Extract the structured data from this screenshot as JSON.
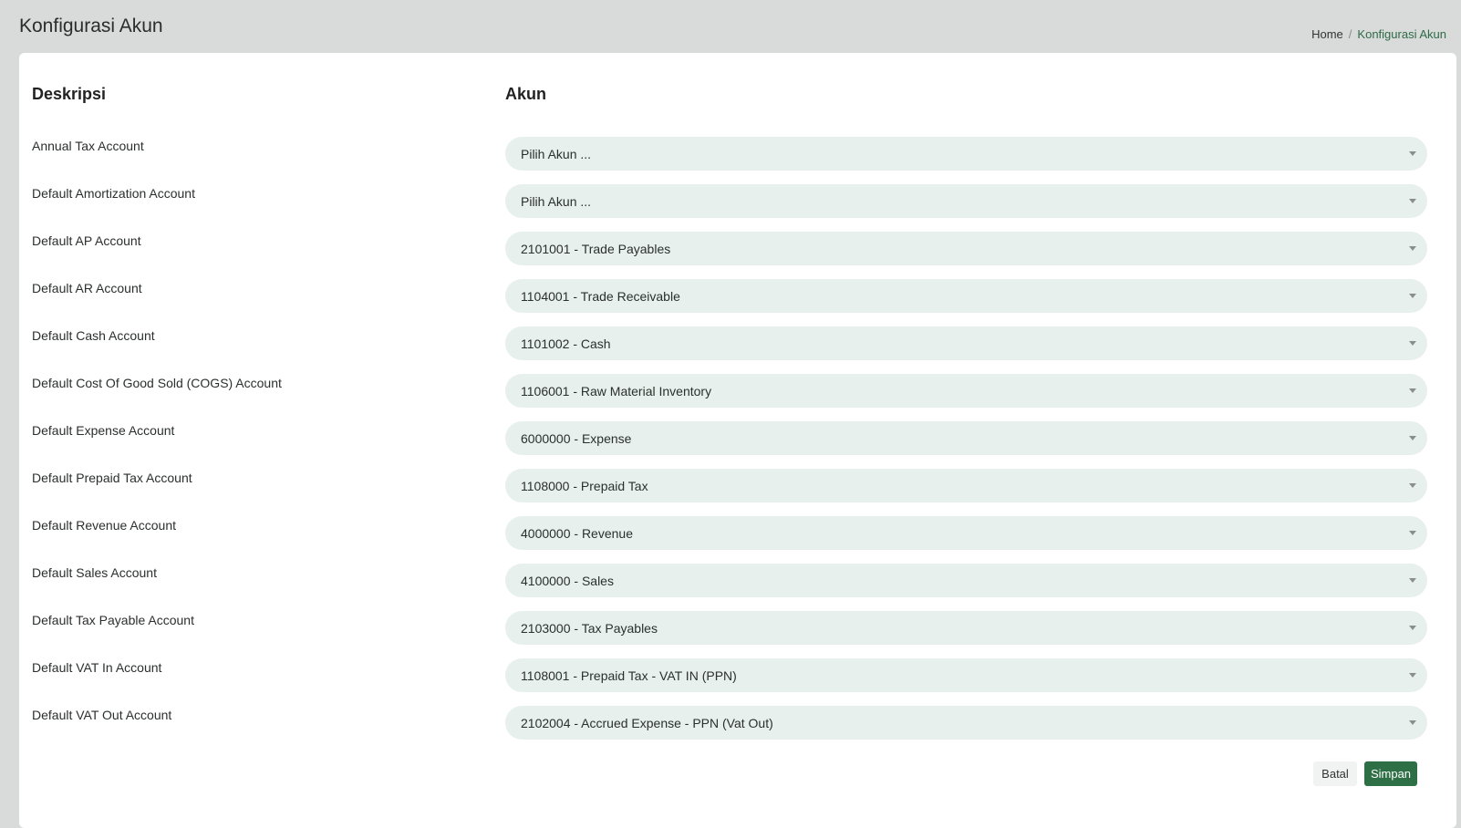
{
  "header": {
    "title": "Konfigurasi Akun",
    "breadcrumb": {
      "home": "Home",
      "separator": "/",
      "current": "Konfigurasi Akun"
    }
  },
  "table": {
    "col_description": "Deskripsi",
    "col_account": "Akun",
    "rows": [
      {
        "label": "Annual Tax Account",
        "value": "Pilih Akun ..."
      },
      {
        "label": "Default Amortization Account",
        "value": "Pilih Akun ..."
      },
      {
        "label": "Default AP Account",
        "value": "2101001 - Trade Payables"
      },
      {
        "label": "Default AR Account",
        "value": "1104001 - Trade Receivable"
      },
      {
        "label": "Default Cash Account",
        "value": "1101002 - Cash"
      },
      {
        "label": "Default Cost Of Good Sold (COGS) Account",
        "value": "1106001 - Raw Material Inventory"
      },
      {
        "label": "Default Expense Account",
        "value": "6000000 - Expense"
      },
      {
        "label": "Default Prepaid Tax Account",
        "value": "1108000 - Prepaid Tax"
      },
      {
        "label": "Default Revenue Account",
        "value": "4000000 - Revenue"
      },
      {
        "label": "Default Sales Account",
        "value": "4100000 - Sales"
      },
      {
        "label": "Default Tax Payable Account",
        "value": "2103000 - Tax Payables"
      },
      {
        "label": "Default VAT In Account",
        "value": "1108001 - Prepaid Tax - VAT IN (PPN)"
      },
      {
        "label": "Default VAT Out Account",
        "value": "2102004 - Accrued Expense - PPN (Vat Out)"
      }
    ]
  },
  "actions": {
    "cancel_label": "Batal",
    "save_label": "Simpan"
  },
  "colors": {
    "background": "#d8dbda",
    "select_bg": "#e7f0ec",
    "accent": "#2f6f45"
  }
}
